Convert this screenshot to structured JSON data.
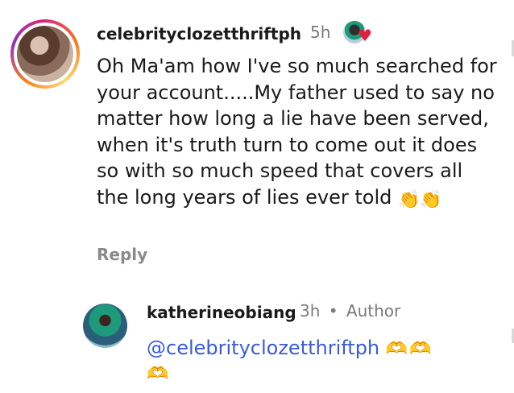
{
  "comment": {
    "username": "celebrityclozetthriftph",
    "time": "5h",
    "text": "Oh Ma'am how I've so much searched for your account.....My father used to say no matter how long a lie have been served, when it's truth turn to come out it does so with so much speed that covers all the long years of lies ever told",
    "emoji": "👏👏",
    "reply_label": "Reply",
    "like_icon": "heart-icon"
  },
  "reply": {
    "username": "katherineobiang",
    "time": "3h",
    "separator": "•",
    "badge": "Author",
    "mention": "@celebrityclozetthriftph",
    "emoji": "🫶🫶",
    "emoji2": "🫶"
  },
  "colors": {
    "mention": "#3b5bdb",
    "meta": "#7a7a7a",
    "heart": "#e0203c"
  }
}
